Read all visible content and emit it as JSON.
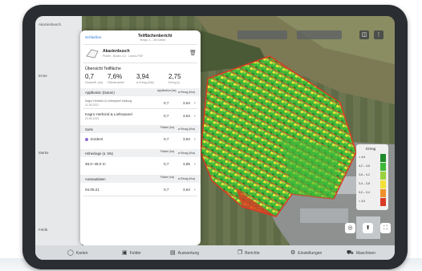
{
  "header": {
    "back_label": "Schließen",
    "title": "Teilflächenbericht",
    "subtitle": "Tempo 1 – 35 Karten"
  },
  "field": {
    "name": "Akazienbusch",
    "meta": "Pluhfe - Boden 4,0 · Lizenz-PDF"
  },
  "overview": {
    "title": "Übersicht Teilfläche",
    "stats": [
      {
        "value": "0,7",
        "label": "Gesamtfl. (ha)"
      },
      {
        "value": "7,6%",
        "label": "Flächenanteil"
      },
      {
        "value": "3,94",
        "label": "ø Ertrag (t/ha)"
      },
      {
        "value": "2,75",
        "label": "Ertrag (t)"
      }
    ]
  },
  "sections": {
    "applications": {
      "col1": "Applikation (Datum)",
      "col2": "Applikation (ha)",
      "col3": "ø Ertrag (t/ha)",
      "rows": [
        {
          "name": "Kagro Herbizid & Lieferpanel Kalkung",
          "date": "11.05.2021",
          "area": "0,7",
          "yield": "3,64"
        },
        {
          "name": "Kagro Herbizid & Lieferpanel",
          "date": "23.05.2021",
          "area": "0,7",
          "yield": "3,64"
        }
      ]
    },
    "varieties": {
      "col1": "Sorte",
      "col2": "Fläche (ha)",
      "col3": "ø Ertrag (t/ha)",
      "rows": [
        {
          "name": "Evident",
          "area": "0,7",
          "yield": "3,94"
        }
      ]
    },
    "elevation": {
      "col1": "Höhenlage (ü. NN)",
      "col2": "Fläche (ha)",
      "col3": "ø Ertrag (t/ha)",
      "rows": [
        {
          "name": "48,0–49,0 m",
          "area": "0,7",
          "yield": "3,85"
        }
      ]
    },
    "sowing": {
      "col1": "Aussaatdaten",
      "col2": "Fläche (ha)",
      "col3": "ø Ertrag (t/ha)",
      "rows": [
        {
          "name": "04.08.21",
          "area": "0,7",
          "yield": "3,84"
        }
      ]
    }
  },
  "left_labels": [
    "Akazienbusch",
    "Ernte",
    "Marke",
    "Feldb"
  ],
  "legend": {
    "title": "Ertrag",
    "entries": [
      "> 4,6",
      "4,2 – 4,6",
      "3,8 – 4,2",
      "3,4 – 3,8",
      "3,0 – 3,4",
      "< 3,0"
    ],
    "colors": [
      "#1e8a2a",
      "#3fb83a",
      "#9ad13c",
      "#f2e035",
      "#f0902a",
      "#d93a24"
    ]
  },
  "bottom_bar": [
    {
      "icon": "circle-icon",
      "glyph": "◯",
      "label": "Karten"
    },
    {
      "icon": "layers-icon",
      "glyph": "▣",
      "label": "Felder"
    },
    {
      "icon": "report-icon",
      "glyph": "▤",
      "label": "Auswertung"
    },
    {
      "icon": "document-icon",
      "glyph": "❐",
      "label": "Berichte"
    },
    {
      "icon": "gear-icon",
      "glyph": "⚙",
      "label": "Einstellungen"
    },
    {
      "icon": "tractor-icon",
      "glyph": "⛟",
      "label": "Maschinen"
    }
  ]
}
